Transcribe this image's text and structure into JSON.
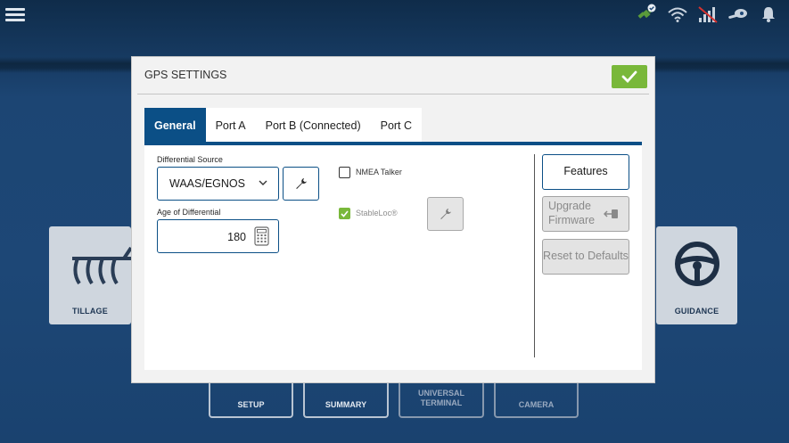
{
  "statusbar": {
    "icons": [
      "satellite-check-icon",
      "wifi-icon",
      "cellular-no-signal-icon",
      "sensor-icon",
      "bell-icon"
    ]
  },
  "background": {
    "tile_left_label": "TILLAGE",
    "tile_right_label": "GUIDANCE",
    "bottom_buttons": [
      "SETUP",
      "SUMMARY",
      "UNIVERSAL TERMINAL",
      "CAMERA"
    ]
  },
  "dialog": {
    "title": "GPS SETTINGS",
    "tabs": [
      {
        "label": "General",
        "active": true
      },
      {
        "label": "Port A",
        "active": false
      },
      {
        "label": "Port B (Connected)",
        "active": false
      },
      {
        "label": "Port C",
        "active": false
      }
    ],
    "differential_source": {
      "label": "Differential Source",
      "value": "WAAS/EGNOS"
    },
    "age_of_differential": {
      "label": "Age of Differential",
      "value": "180"
    },
    "nmea_talker": {
      "label": "NMEA Talker",
      "checked": false
    },
    "stableloc": {
      "label": "StableLoc®",
      "checked": true,
      "enabled": false
    },
    "buttons": {
      "features": "Features",
      "upgrade_firmware": "Upgrade Firmware",
      "reset_defaults": "Reset to Defaults"
    }
  },
  "colors": {
    "accent": "#0b4f86",
    "ok_green": "#79b83a",
    "disabled": "#e3e3e3"
  }
}
